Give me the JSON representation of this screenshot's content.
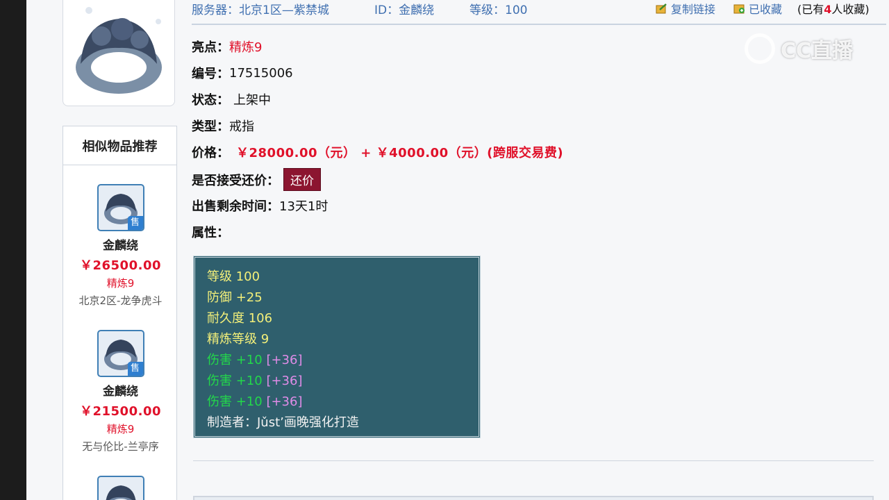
{
  "topbar": {
    "server": "服务器：北京1区—紫禁城",
    "id": "ID：金麟绕",
    "level": "等级：100",
    "copy_link": "复制链接",
    "favorited": "已收藏",
    "fav_count_prefix": "(已有",
    "fav_count": "4",
    "fav_count_suffix": "人收藏)"
  },
  "detail": {
    "highlight_label": "亮点：",
    "highlight_value": "精炼9",
    "number_label": "编号：",
    "number_value": "17515006",
    "status_label": "状态：",
    "status_value": "上架中",
    "type_label": "类型：",
    "type_value": "戒指",
    "price_label": "价格：",
    "price_value": "￥28000.00（元） + ￥4000.00（元）(跨服交易费)",
    "counter_label": "是否接受还价：",
    "counter_button": "还价",
    "time_label": "出售剩余时间：",
    "time_value": "13天1时",
    "attr_label": "属性："
  },
  "attributes": [
    {
      "text": "等级 100",
      "color": "yellow"
    },
    {
      "text": "防御 +25",
      "color": "yellow"
    },
    {
      "text": "耐久度 106",
      "color": "yellow"
    },
    {
      "text": "精炼等级 9",
      "color": "yellow"
    },
    {
      "text": "伤害 +10",
      "extra": "[+36]",
      "color": "green"
    },
    {
      "text": "伤害 +10",
      "extra": "[+36]",
      "color": "green"
    },
    {
      "text": "伤害 +10",
      "extra": "[+36]",
      "color": "green"
    },
    {
      "text": "制造者：Jǔst’画晚强化打造",
      "color": "white"
    }
  ],
  "similar": {
    "title": "相似物品推荐",
    "sell_badge": "售",
    "items": [
      {
        "name": "金麟绕",
        "price": "￥26500.00",
        "refine": "精炼9",
        "server": "北京2区-龙争虎斗"
      },
      {
        "name": "金麟绕",
        "price": "￥21500.00",
        "refine": "精炼9",
        "server": "无与伦比-兰亭序"
      }
    ]
  },
  "watermark": {
    "text": "CC直播"
  }
}
